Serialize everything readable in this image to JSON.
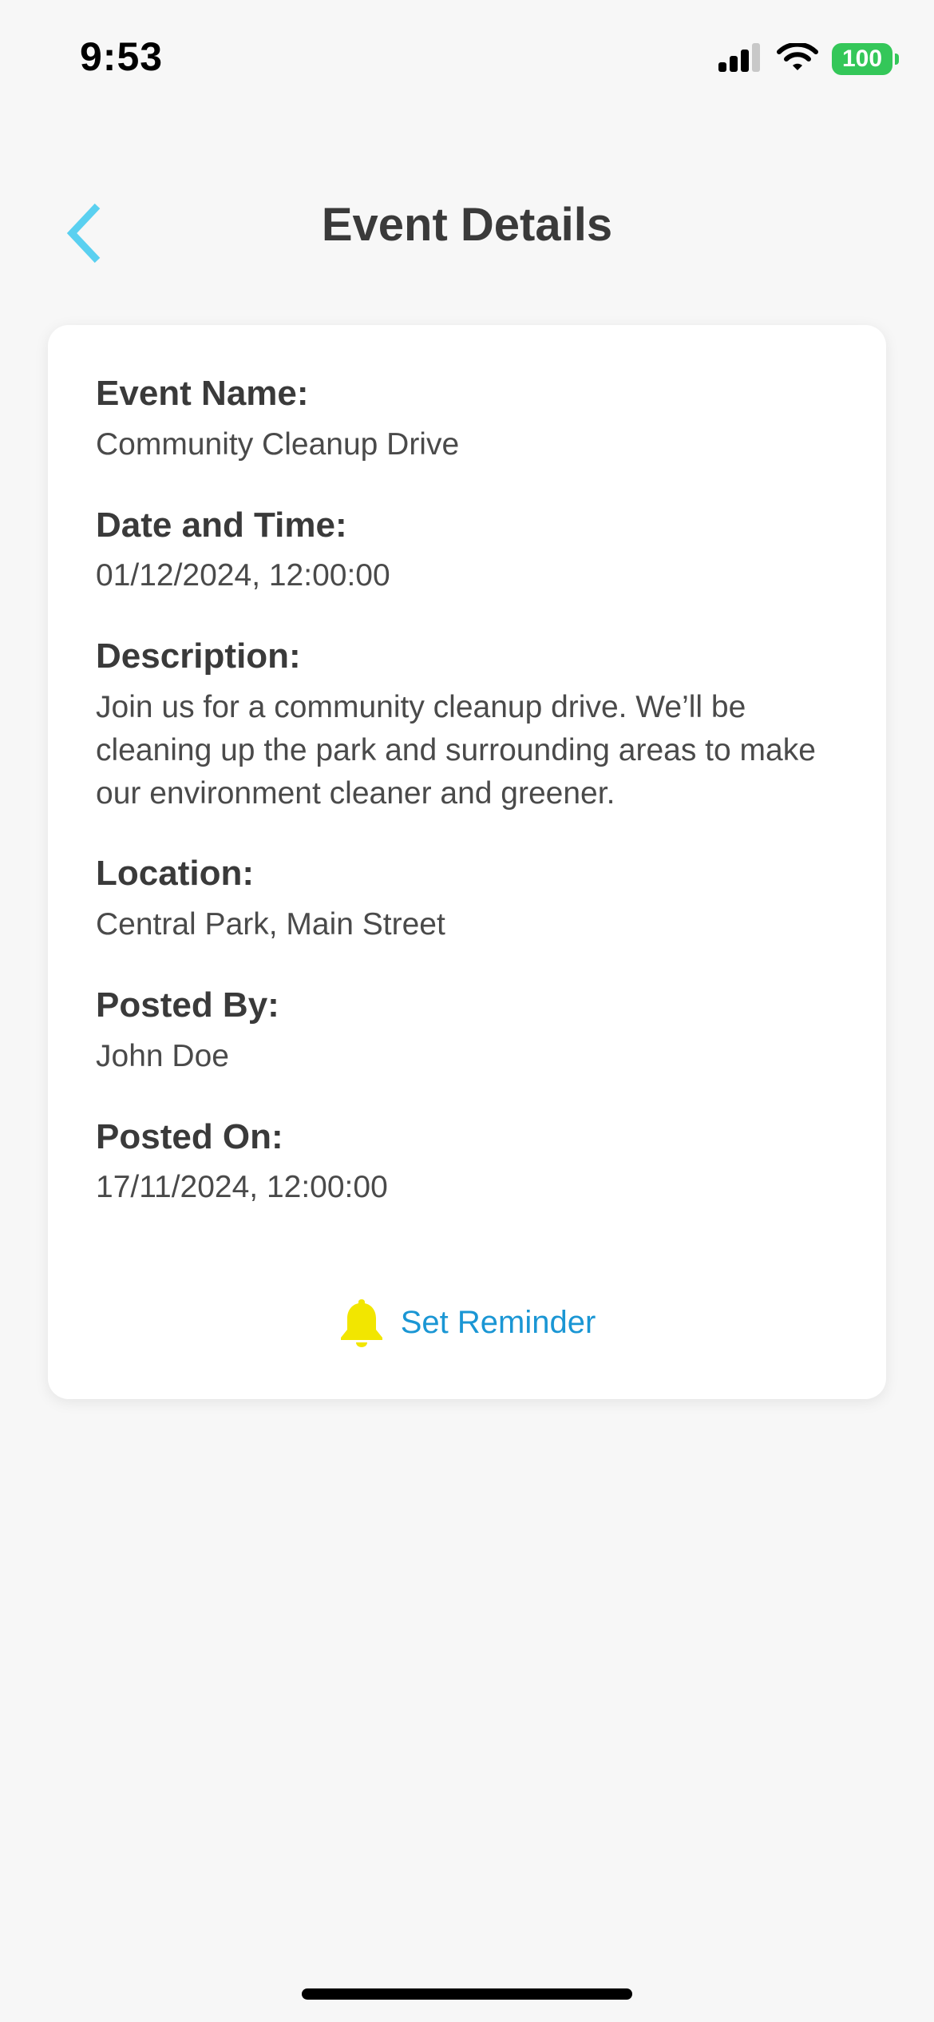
{
  "status_bar": {
    "time": "9:53",
    "battery": "100"
  },
  "header": {
    "title": "Event Details",
    "back_icon": "chevron-left-icon",
    "accent_color": "#5ad0f0"
  },
  "event": {
    "fields": [
      {
        "label": "Event Name:",
        "value": "Community Cleanup Drive"
      },
      {
        "label": "Date and Time:",
        "value": "01/12/2024, 12:00:00"
      },
      {
        "label": "Description:",
        "value": "Join us for a community cleanup drive. We’ll be cleaning up the park and surrounding areas to make our environment cleaner and greener."
      },
      {
        "label": "Location:",
        "value": "Central Park, Main Street"
      },
      {
        "label": "Posted By:",
        "value": "John Doe"
      },
      {
        "label": "Posted On:",
        "value": "17/11/2024, 12:00:00"
      }
    ]
  },
  "reminder": {
    "label": "Set Reminder",
    "icon": "bell-icon",
    "icon_color": "#f2e600",
    "text_color": "#1a96d4"
  }
}
